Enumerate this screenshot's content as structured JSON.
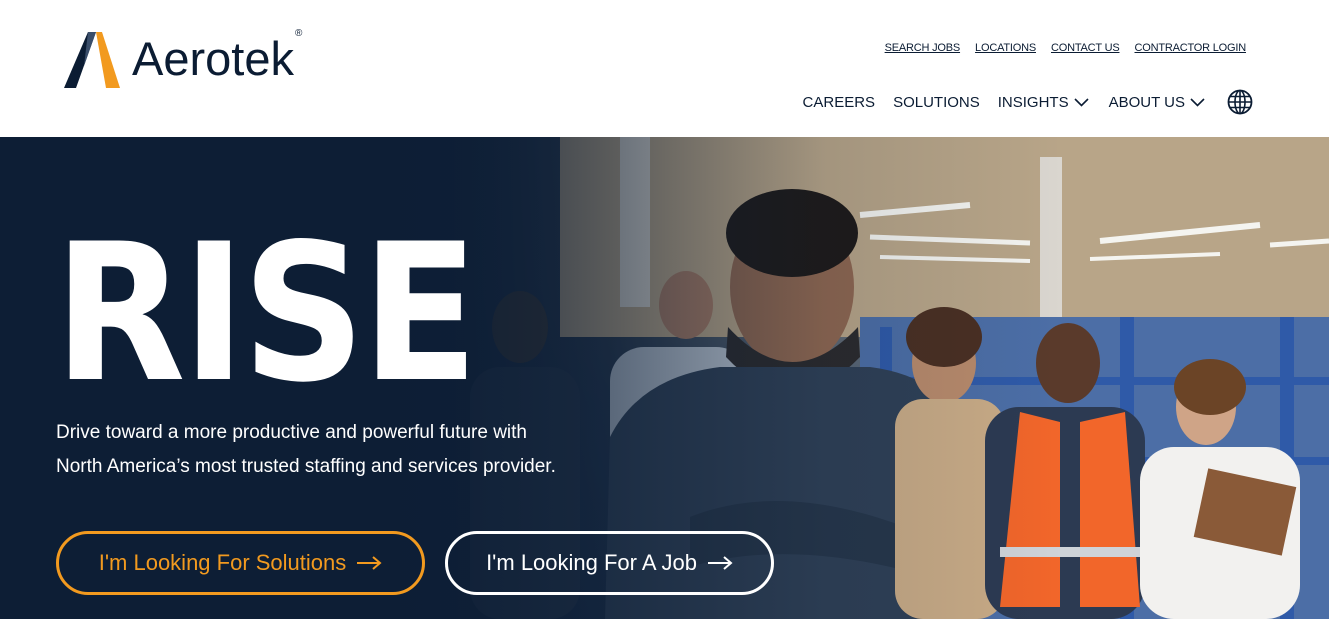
{
  "brand": {
    "name": "Aerotek",
    "registered": "®",
    "colors": {
      "navy": "#0b1c33",
      "orange": "#f29a1f",
      "white": "#ffffff"
    },
    "logo_icon": "aerotek-a-mark-icon"
  },
  "utility_nav": [
    {
      "label": "SEARCH JOBS"
    },
    {
      "label": "LOCATIONS"
    },
    {
      "label": "CONTACT US"
    },
    {
      "label": "CONTRACTOR LOGIN"
    }
  ],
  "main_nav": {
    "careers": "CAREERS",
    "solutions": "SOLUTIONS",
    "insights": "INSIGHTS",
    "about": "ABOUT US",
    "dropdown_icon": "chevron-down-icon",
    "language_icon": "globe-icon"
  },
  "hero": {
    "title": "RISE",
    "subtitle": "Drive toward a more productive and powerful future with North America’s most trusted staffing and services provider.",
    "buttons": {
      "solutions": "I'm Looking For Solutions",
      "job": "I'm Looking For A Job",
      "arrow_icon": "arrow-right-icon"
    }
  }
}
